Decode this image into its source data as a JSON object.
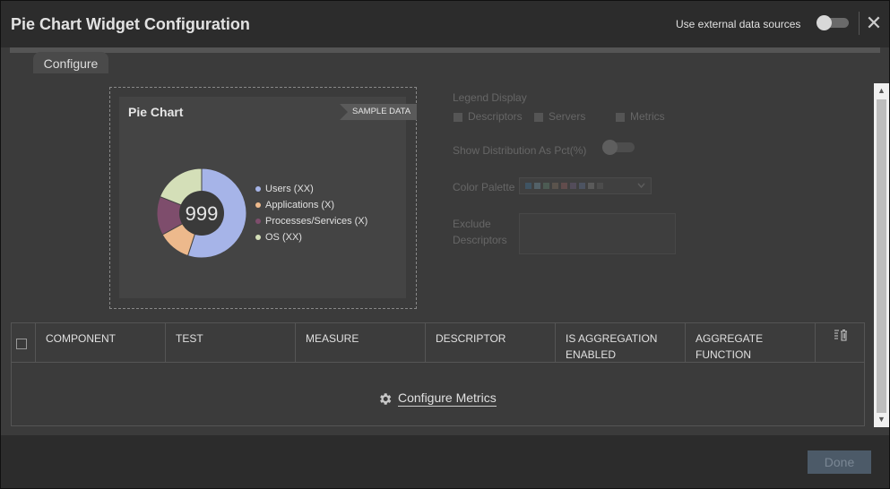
{
  "header": {
    "title": "Pie Chart Widget Configuration",
    "external_label": "Use external data sources",
    "close_glyph": "✕"
  },
  "tabs": [
    {
      "label": "Configure"
    }
  ],
  "preview": {
    "card_title": "Pie Chart",
    "sample_badge": "SAMPLE DATA",
    "center_value": "999",
    "legend": [
      {
        "label": "Users (XX)",
        "color": "#a6b4e8"
      },
      {
        "label": "Applications (X)",
        "color": "#edb98c"
      },
      {
        "label": "Processes/Services (X)",
        "color": "#7e4d6c"
      },
      {
        "label": "OS (XX)",
        "color": "#d4dfb8"
      }
    ]
  },
  "chart_data": {
    "type": "pie",
    "categories": [
      "Users (XX)",
      "Applications (X)",
      "Processes/Services (X)",
      "OS (XX)"
    ],
    "values": [
      55,
      12,
      14,
      19
    ],
    "colors": [
      "#a6b4e8",
      "#edb98c",
      "#7e4d6c",
      "#d4dfb8"
    ]
  },
  "form": {
    "legend_display_label": "Legend Display",
    "legend_options": [
      "Descriptors",
      "Servers",
      "Metrics"
    ],
    "distribution_label": "Show Distribution As Pct(%)",
    "palette_label": "Color Palette",
    "palette_colors": [
      "#3d6d8e",
      "#6b8a9a",
      "#5a7c6a",
      "#7a6a5a",
      "#8a5a5a",
      "#6a5a7a",
      "#5a6a8a",
      "#7a7a7a",
      "#5a5a5a"
    ],
    "exclude_label_1": "Exclude",
    "exclude_label_2": "Descriptors"
  },
  "table": {
    "columns": [
      "COMPONENT",
      "TEST",
      "MEASURE",
      "DESCRIPTOR",
      "IS AGGREGATION ENABLED",
      "AGGREGATE FUNCTION"
    ],
    "empty_action": "Configure Metrics"
  },
  "footer": {
    "done_label": "Done"
  }
}
